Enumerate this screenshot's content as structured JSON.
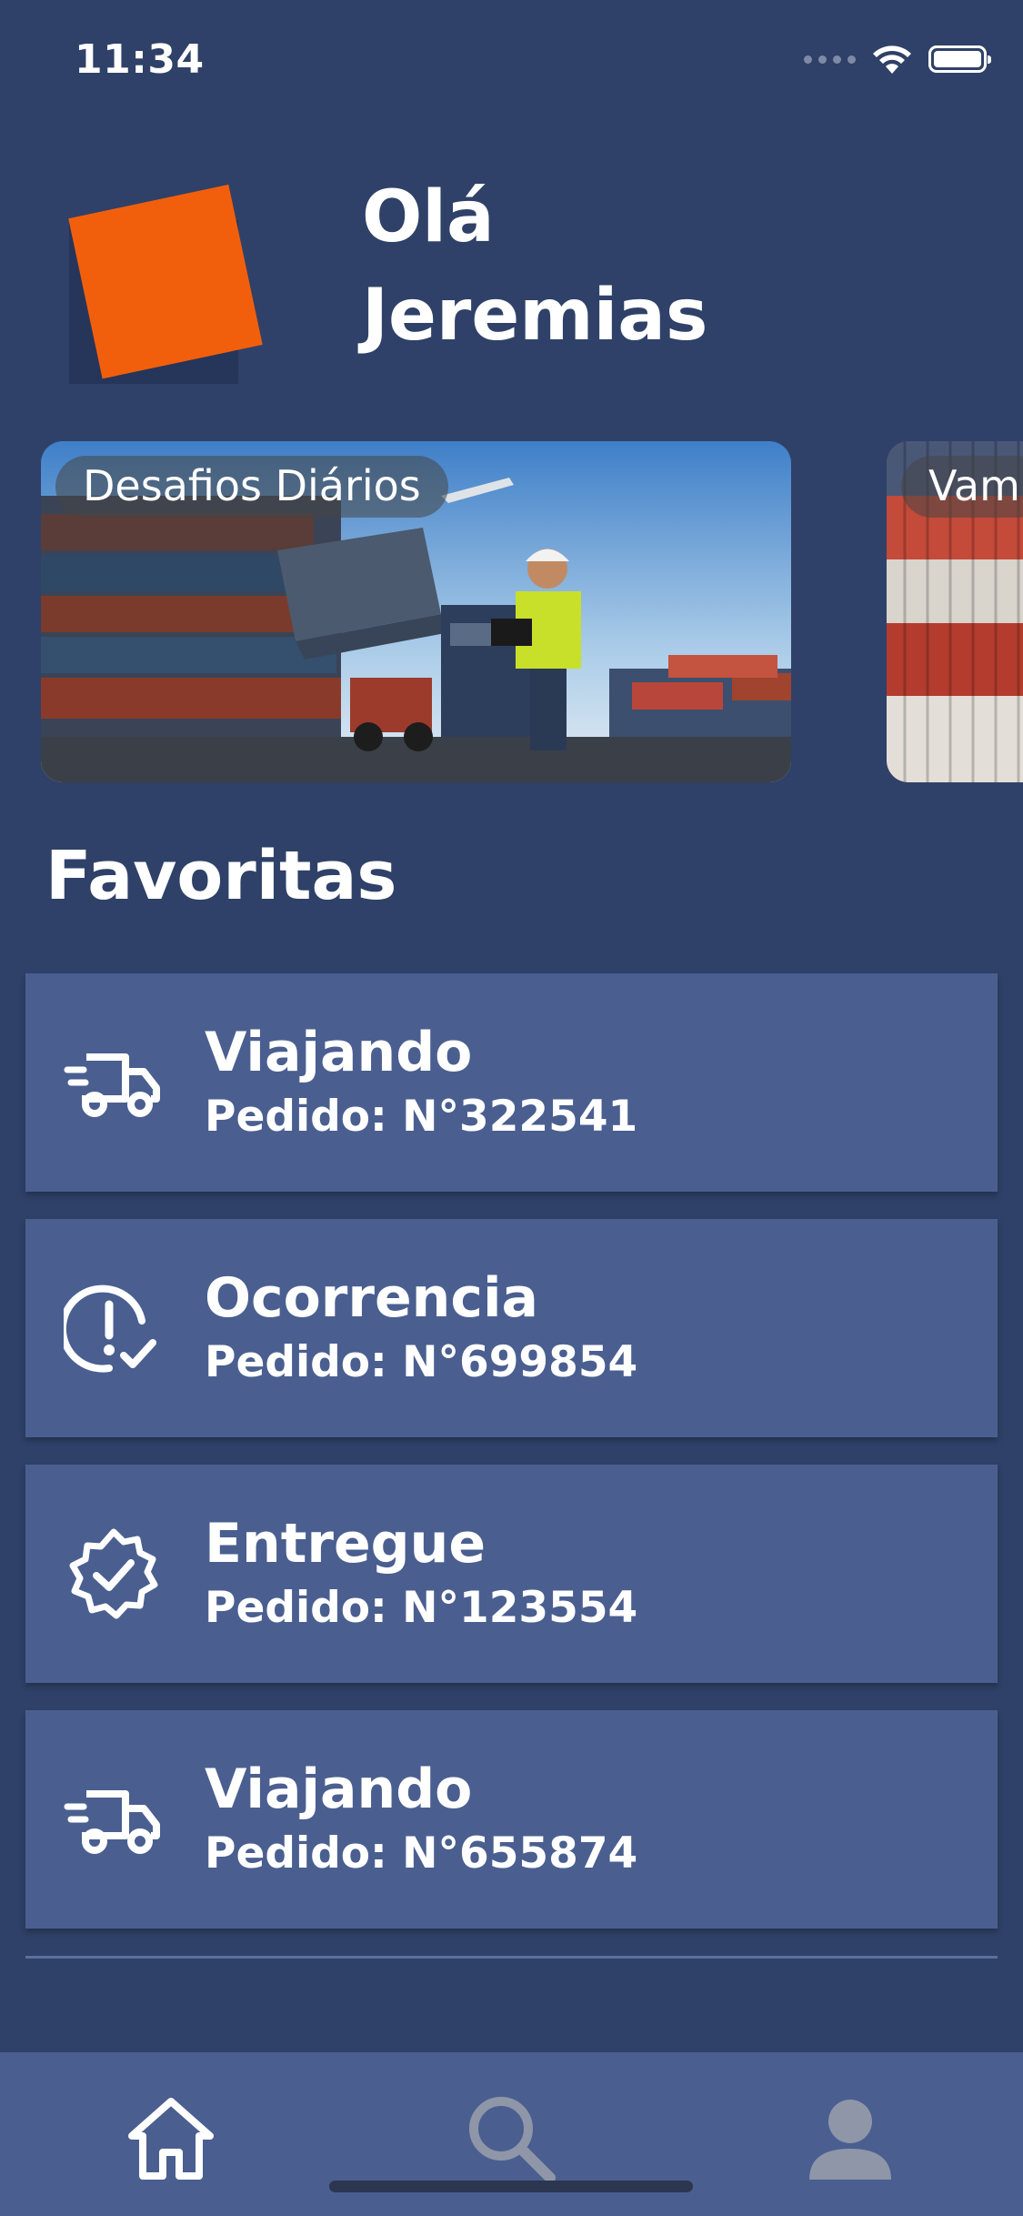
{
  "status_bar": {
    "time": "11:34"
  },
  "header": {
    "greeting_line1": "Olá",
    "greeting_line2": "Jeremias"
  },
  "carousel": {
    "cards": [
      {
        "label": "Desafios Diários"
      },
      {
        "label": "Vam"
      }
    ]
  },
  "favorites": {
    "title": "Favoritas",
    "items": [
      {
        "status": "Viajando",
        "order": "Pedido: N°322541",
        "icon": "truck-icon"
      },
      {
        "status": "Ocorrencia",
        "order": "Pedido: N°699854",
        "icon": "alert-check-icon"
      },
      {
        "status": "Entregue",
        "order": "Pedido: N°123554",
        "icon": "verified-badge-icon"
      },
      {
        "status": "Viajando",
        "order": "Pedido: N°655874",
        "icon": "truck-icon"
      }
    ]
  },
  "tab_bar": {
    "items": [
      {
        "name": "home",
        "icon": "home-icon",
        "active": true
      },
      {
        "name": "search",
        "icon": "search-icon",
        "active": false
      },
      {
        "name": "profile",
        "icon": "person-icon",
        "active": false
      }
    ]
  },
  "colors": {
    "background": "#2f4168",
    "card": "#4a5f90",
    "accent": "#f25f0c"
  }
}
